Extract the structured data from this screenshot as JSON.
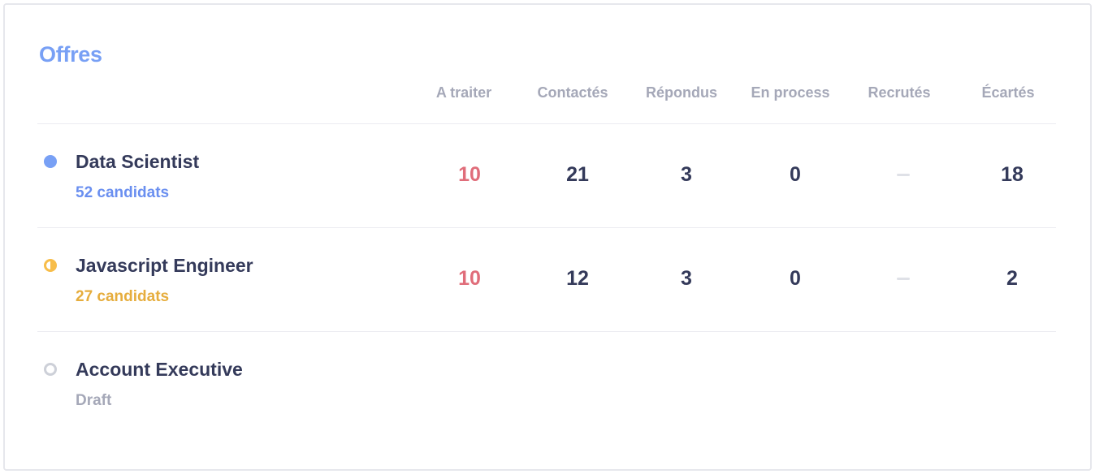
{
  "section": {
    "title": "Offres"
  },
  "columns": [
    "A traiter",
    "Contactés",
    "Répondus",
    "En process",
    "Recrutés",
    "Écartés"
  ],
  "offers": [
    {
      "name": "Data Scientist",
      "subtitle": "52 candidats",
      "status_icon": "filled-circle-icon",
      "accent": "#78a0f5",
      "values": [
        "10",
        "21",
        "3",
        "0",
        "–",
        "18"
      ]
    },
    {
      "name": "Javascript Engineer",
      "subtitle": "27 candidats",
      "status_icon": "half-circle-icon",
      "accent": "#f7bd4a",
      "values": [
        "10",
        "12",
        "3",
        "0",
        "–",
        "2"
      ]
    },
    {
      "name": "Account Executive",
      "subtitle": "Draft",
      "status_icon": "empty-circle-icon",
      "accent": "#cdd0d8",
      "values": []
    }
  ],
  "colors": {
    "to_process": "#e06d7a",
    "text": "#343a5a",
    "muted": "#a5a8b8"
  }
}
